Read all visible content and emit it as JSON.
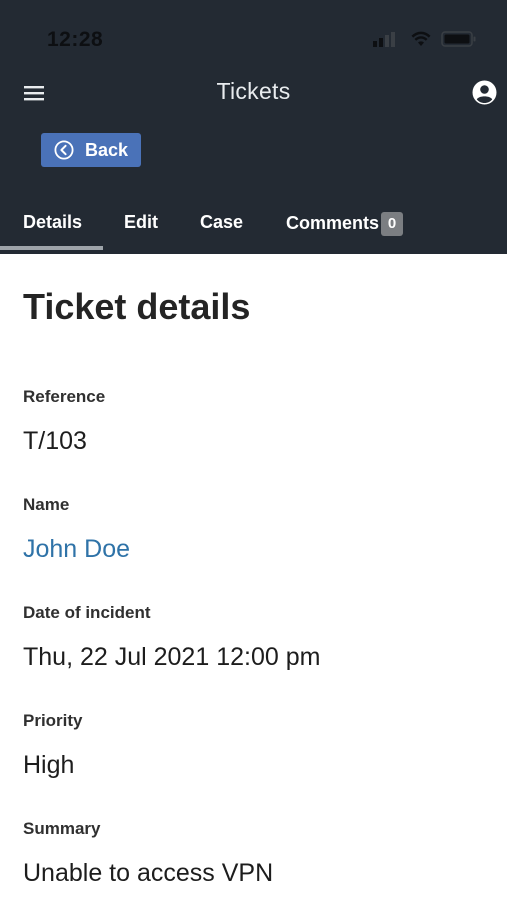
{
  "status_bar": {
    "time": "12:28",
    "icons": [
      "signal-icon",
      "wifi-icon",
      "battery-icon"
    ]
  },
  "header": {
    "title": "Tickets",
    "menu_icon": "hamburger-menu-icon",
    "account_icon": "account-circle-icon"
  },
  "back_button": {
    "label": "Back",
    "icon": "circle-chevron-left-icon"
  },
  "tabs": [
    {
      "label": "Details",
      "active": true
    },
    {
      "label": "Edit",
      "active": false
    },
    {
      "label": "Case",
      "active": false
    },
    {
      "label": "Comments",
      "active": false,
      "badge": "0"
    }
  ],
  "page": {
    "title": "Ticket details",
    "fields": [
      {
        "label": "Reference",
        "value": "T/103"
      },
      {
        "label": "Name",
        "value": "John Doe",
        "link": true
      },
      {
        "label": "Date of incident",
        "value": "Thu, 22 Jul 2021 12:00 pm"
      },
      {
        "label": "Priority",
        "value": "High"
      },
      {
        "label": "Summary",
        "value": "Unable to access VPN"
      }
    ]
  },
  "colors": {
    "header_bg": "#232a33",
    "back_button_bg": "#4a72b8",
    "link": "#2f73a8",
    "badge_bg": "#7b7e82",
    "active_tab_underline": "#9da3a9"
  }
}
